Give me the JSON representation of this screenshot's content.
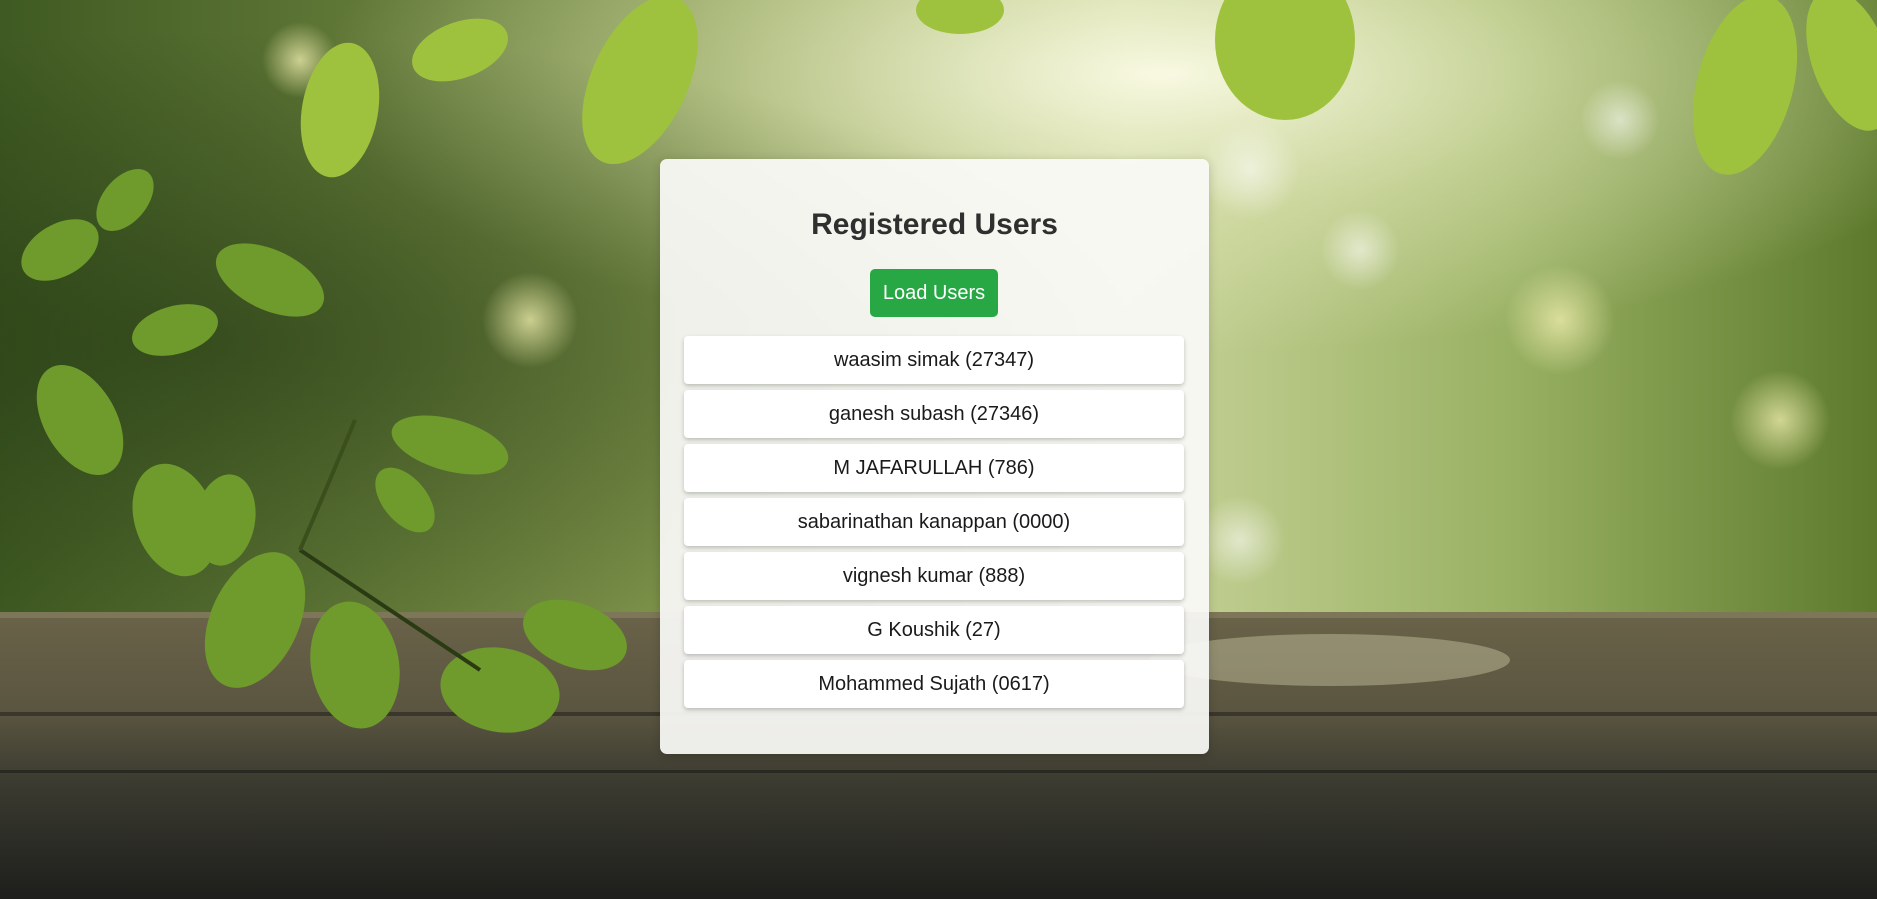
{
  "card": {
    "title": "Registered Users",
    "load_button_label": "Load Users",
    "button_color": "#28a745"
  },
  "users": [
    {
      "label": "waasim simak (27347)"
    },
    {
      "label": "ganesh subash (27346)"
    },
    {
      "label": "M JAFARULLAH (786)"
    },
    {
      "label": "sabarinathan kanappan (0000)"
    },
    {
      "label": "vignesh kumar (888)"
    },
    {
      "label": "G Koushik (27)"
    },
    {
      "label": "Mohammed Sujath (0617)"
    }
  ]
}
